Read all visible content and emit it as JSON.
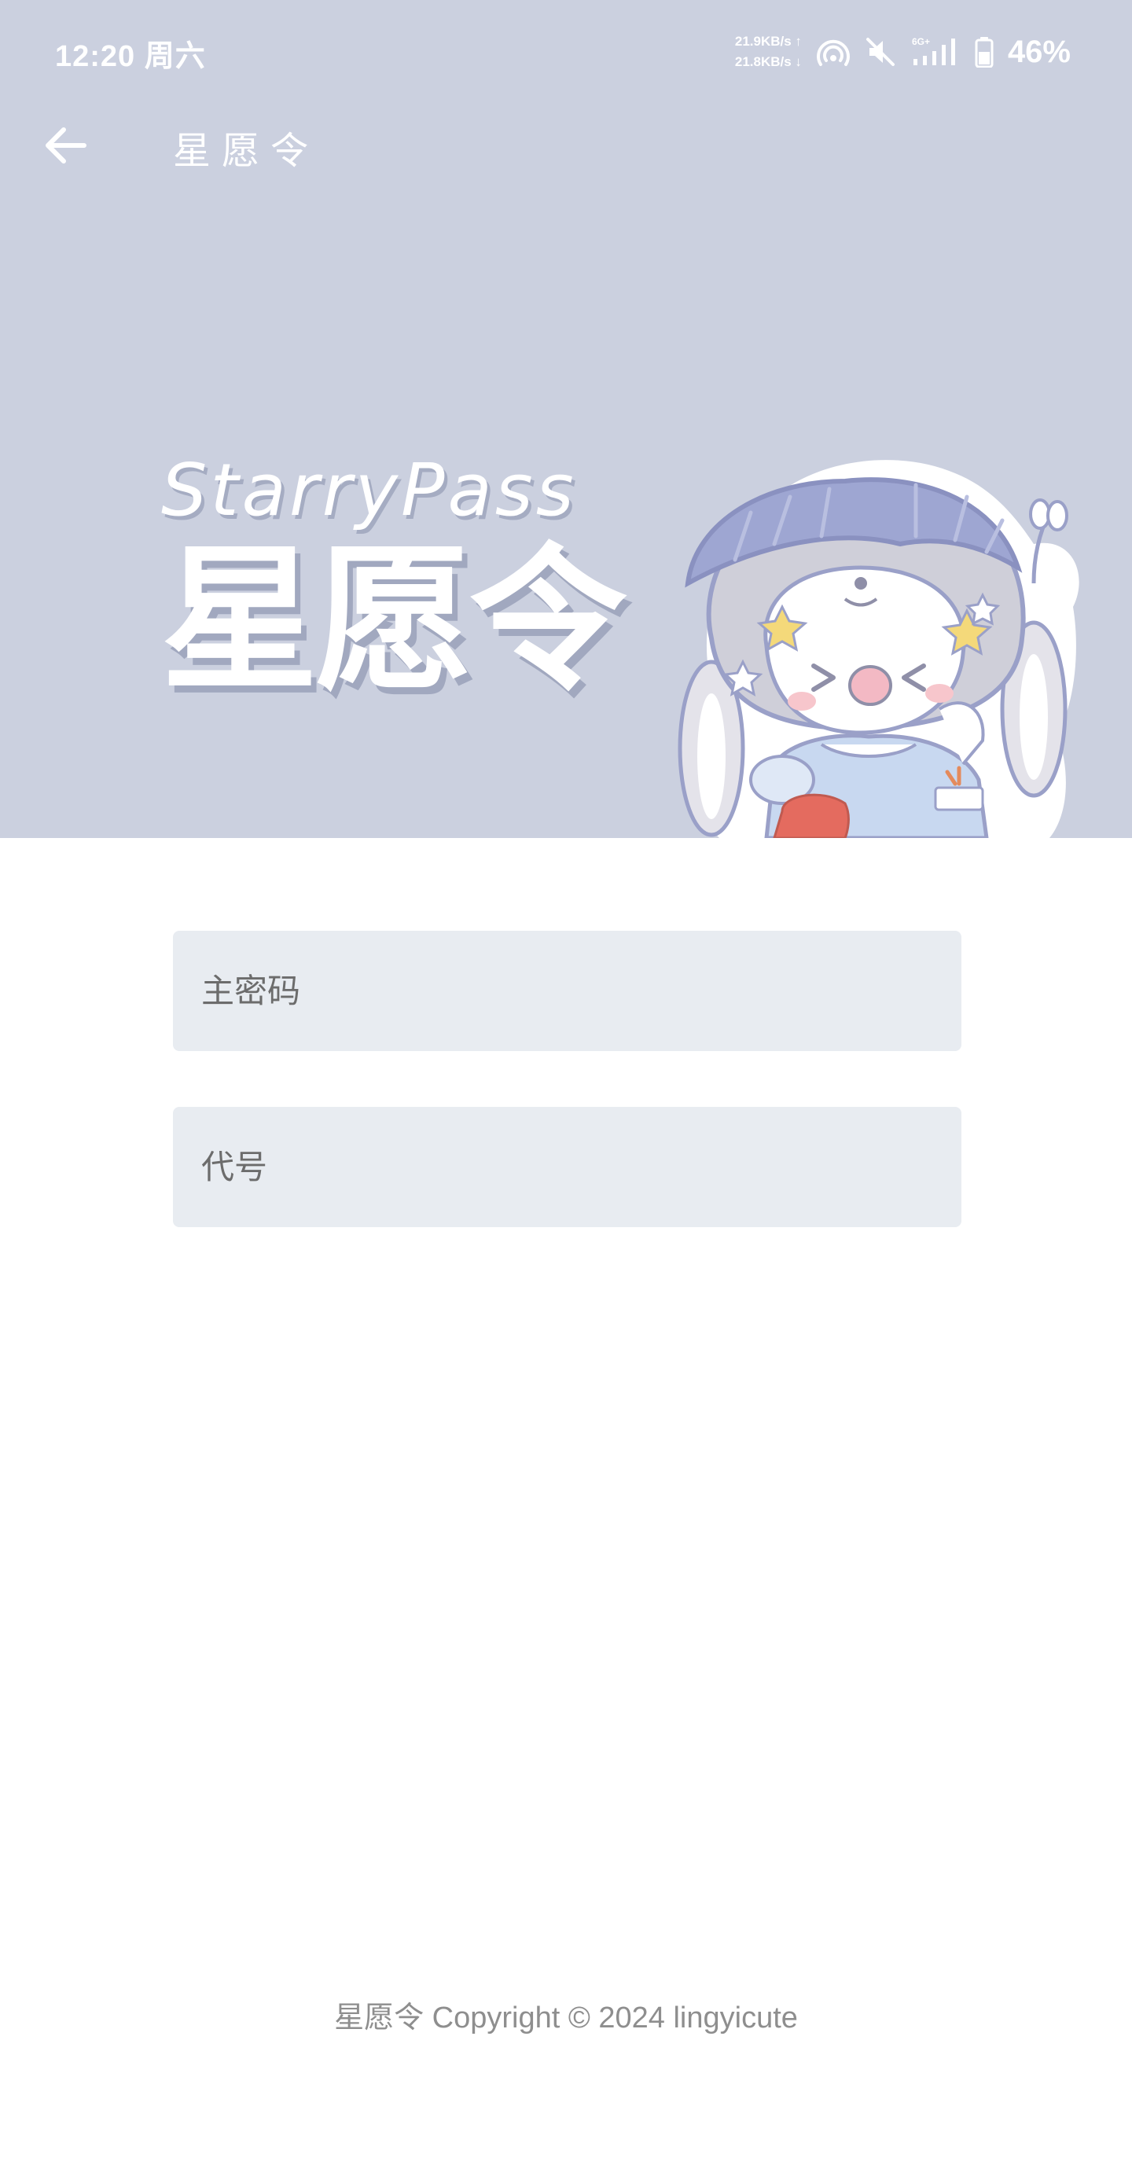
{
  "status_bar": {
    "time": "12:20 周六",
    "upload_speed": "21.9KB/s ↑",
    "download_speed": "21.8KB/s ↓",
    "network_type": "6G+",
    "battery": "46%",
    "icons": [
      "hotspot-icon",
      "mute-icon",
      "signal-icon",
      "battery-icon"
    ]
  },
  "app_bar": {
    "title": "星愿令",
    "back_icon": "arrow-left-icon"
  },
  "hero": {
    "brand_en": "StarryPass",
    "brand_cn": "星愿令",
    "background_color": "#cbd0df",
    "mascot": "bunny-hood-character-illustration"
  },
  "form": {
    "master_password": {
      "placeholder": "主密码",
      "value": ""
    },
    "code": {
      "placeholder": "代号",
      "value": ""
    },
    "field_background": "#e8ecf1"
  },
  "footer": {
    "text": "星愿令 Copyright © 2024 lingyicute"
  }
}
